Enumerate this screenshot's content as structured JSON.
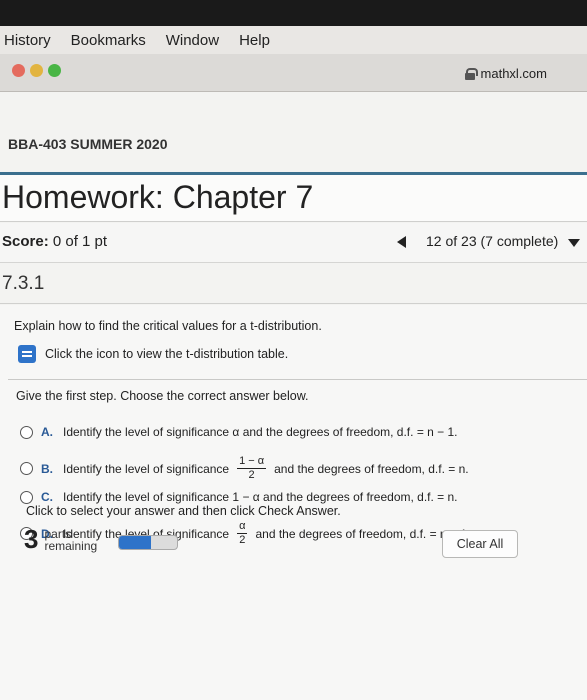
{
  "menubar": {
    "items": [
      "History",
      "Bookmarks",
      "Window",
      "Help"
    ]
  },
  "browser": {
    "url": "mathxl.com"
  },
  "course": {
    "name": "BBA-403 SUMMER 2020"
  },
  "homework": {
    "title": "Homework: Chapter 7"
  },
  "score": {
    "label": "Score:",
    "value": "0 of 1 pt"
  },
  "progress": {
    "text": "12 of 23 (7 complete)"
  },
  "question": {
    "number": "7.3.1",
    "prompt": "Explain how to find the critical values for a t-distribution.",
    "table_link": "Click the icon to view the t-distribution table.",
    "instruction": "Give the first step. Choose the correct answer below.",
    "options": [
      {
        "letter": "A.",
        "text": "Identify the level of significance α and the degrees of freedom, d.f. = n − 1."
      },
      {
        "letter": "B.",
        "pre": "Identify the level of significance",
        "num": "1 − α",
        "den": "2",
        "post": "and the degrees of freedom, d.f. = n."
      },
      {
        "letter": "C.",
        "text": "Identify the level of significance 1 − α and the degrees of freedom, d.f. = n."
      },
      {
        "letter": "D.",
        "pre": "Identify the level of significance",
        "num": "α",
        "den": "2",
        "post": "and the degrees of freedom, d.f. = n − 1."
      }
    ]
  },
  "footer": {
    "instruction": "Click to select your answer and then click Check Answer.",
    "parts_count": "3",
    "parts_label_1": "parts",
    "parts_label_2": "remaining",
    "progress_fraction": 0.55,
    "clear_label": "Clear All"
  },
  "colors": {
    "accent": "#2e73c9",
    "header_rule": "#3b6f8e"
  }
}
